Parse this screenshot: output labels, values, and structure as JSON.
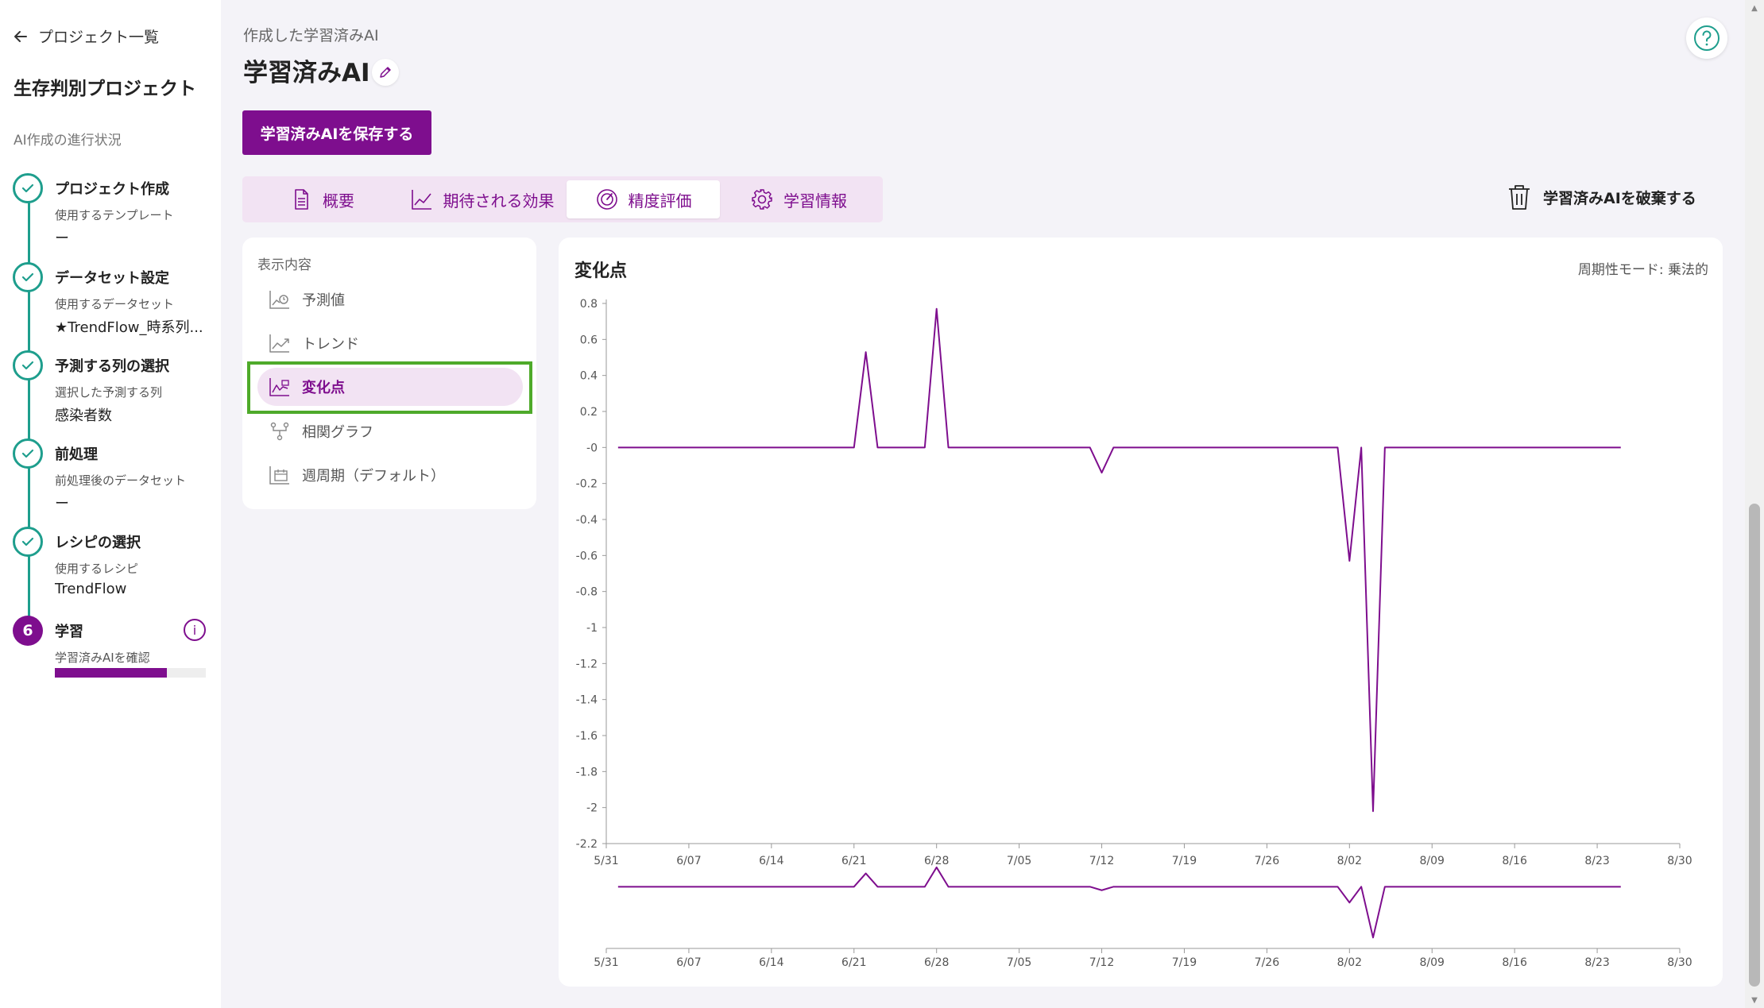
{
  "sidebar": {
    "back_label": "プロジェクト一覧",
    "project_name": "生存判別プロジェクト",
    "progress_label": "AI作成の進行状況",
    "steps": [
      {
        "title": "プロジェクト作成",
        "sub": "使用するテンプレート",
        "value": "ー"
      },
      {
        "title": "データセット設定",
        "sub": "使用するデータセット",
        "value": "★TrendFlow_時系列..."
      },
      {
        "title": "予測する列の選択",
        "sub": "選択した予測する列",
        "value": "感染者数"
      },
      {
        "title": "前処理",
        "sub": "前処理後のデータセット",
        "value": "ー"
      },
      {
        "title": "レシピの選択",
        "sub": "使用するレシピ",
        "value": "TrendFlow"
      },
      {
        "number": "6",
        "title": "学習",
        "sub": "学習済みAIを確認",
        "progress": 0.74
      }
    ]
  },
  "header": {
    "breadcrumb": "作成した学習済みAI",
    "title": "学習済みAI",
    "save_label": "学習済みAIを保存する",
    "discard_label": "学習済みAIを破棄する"
  },
  "tabs": [
    {
      "label": "概要",
      "icon": "document-icon"
    },
    {
      "label": "期待される効果",
      "icon": "line-chart-icon"
    },
    {
      "label": "精度評価",
      "icon": "gauge-icon",
      "active": true
    },
    {
      "label": "学習情報",
      "icon": "gear-icon"
    }
  ],
  "display_panel": {
    "header": "表示内容",
    "items": [
      {
        "label": "予測値",
        "icon": "forecast-icon"
      },
      {
        "label": "トレンド",
        "icon": "trend-icon"
      },
      {
        "label": "変化点",
        "icon": "changepoint-icon",
        "active": true
      },
      {
        "label": "相関グラフ",
        "icon": "correlation-icon"
      },
      {
        "label": "週周期（デフォルト）",
        "icon": "weekly-icon"
      }
    ]
  },
  "chart": {
    "title": "変化点",
    "mode_label": "周期性モード: 乗法的"
  },
  "colors": {
    "accent": "#7e0e8e",
    "teal": "#1e9e8d",
    "highlight": "#4eaa2a"
  },
  "chart_data": {
    "type": "line",
    "title": "変化点",
    "x_ticks": [
      "5/31",
      "6/07",
      "6/14",
      "6/21",
      "6/28",
      "7/05",
      "7/12",
      "7/19",
      "7/26",
      "8/02",
      "8/09",
      "8/16",
      "8/23",
      "8/30"
    ],
    "y_ticks": [
      "0.8",
      "0.6",
      "0.4",
      "0.2",
      "-0",
      "-0.2",
      "-0.4",
      "-0.6",
      "-0.8",
      "-1",
      "-1.2",
      "-1.4",
      "-1.6",
      "-1.8",
      "-2",
      "-2.2"
    ],
    "ylim": [
      -2.2,
      0.8
    ],
    "xlim": [
      0,
      91
    ],
    "x_start_date": "5/31",
    "series": [
      {
        "color": "#7e0e8e",
        "points": [
          [
            1,
            0
          ],
          [
            21,
            0
          ],
          [
            22,
            0.53
          ],
          [
            23,
            0
          ],
          [
            27,
            0
          ],
          [
            28,
            0.77
          ],
          [
            29,
            0
          ],
          [
            41,
            0
          ],
          [
            42,
            -0.14
          ],
          [
            43,
            0
          ],
          [
            62,
            0
          ],
          [
            63,
            -0.63
          ],
          [
            64,
            0
          ],
          [
            65,
            -2.02
          ],
          [
            66,
            0
          ],
          [
            86,
            0
          ]
        ]
      }
    ],
    "overview": true
  }
}
